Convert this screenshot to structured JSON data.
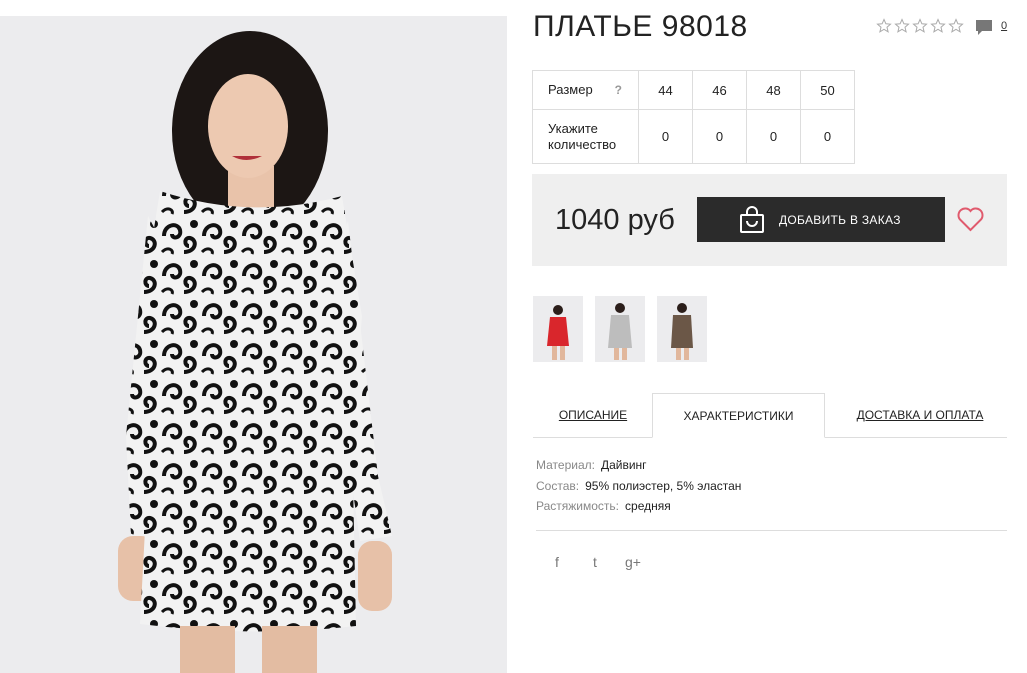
{
  "product": {
    "title": "ПЛАТЬЕ 98018",
    "rating_icons": [
      "star-empty-icon",
      "star-empty-icon",
      "star-empty-icon",
      "star-empty-icon",
      "star-empty-icon"
    ],
    "comments_count": "0"
  },
  "sizes": {
    "size_label": "Размер",
    "help": "?",
    "qty_label": "Укажите количество",
    "values": [
      "44",
      "46",
      "48",
      "50"
    ],
    "quantities": [
      "0",
      "0",
      "0",
      "0"
    ]
  },
  "buy": {
    "price": "1040 руб",
    "add_label": "ДОБАВИТЬ В ЗАКАЗ",
    "heart_color": "#e05a6d"
  },
  "thumbs": [
    {
      "name": "red dress",
      "color": "#d9262c"
    },
    {
      "name": "white-black print dress",
      "color": "#bdbdbd"
    },
    {
      "name": "brown dress",
      "color": "#6b5747"
    }
  ],
  "tabs": [
    {
      "label": "ОПИСАНИЕ",
      "active": false
    },
    {
      "label": "ХАРАКТЕРИСТИКИ",
      "active": true
    },
    {
      "label": "ДОСТАВКА И ОПЛАТА",
      "active": false
    }
  ],
  "characteristics": [
    {
      "key": "Материал:",
      "value": "Дайвинг"
    },
    {
      "key": "Состав:",
      "value": "95% полиэстер, 5% эластан"
    },
    {
      "key": "Растяжимость:",
      "value": "средняя"
    }
  ],
  "social": [
    "f",
    "t",
    "g+"
  ]
}
